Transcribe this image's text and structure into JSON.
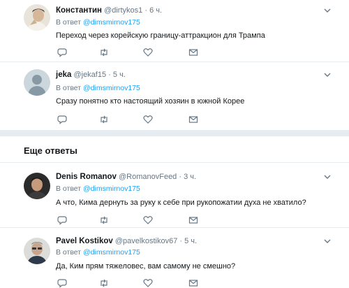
{
  "tweets": [
    {
      "name": "Константин",
      "handle": "@dirtykos1",
      "dot": "·",
      "time": "6 ч.",
      "reply_prefix": "В ответ",
      "reply_mention": "@dimsmirnov175",
      "text": "Переход через корейскую границу-аттракцион для Трампа"
    },
    {
      "name": "jeka",
      "handle": "@jekaf15",
      "dot": "·",
      "time": "5 ч.",
      "reply_prefix": "В ответ",
      "reply_mention": "@dimsmirnov175",
      "text": "Сразу понятно кто настоящий хозяин в южной Корее"
    },
    {
      "name": "Denis Romanov",
      "handle": "@RomanovFeed",
      "dot": "·",
      "time": "3 ч.",
      "reply_prefix": "В ответ",
      "reply_mention": "@dimsmirnov175",
      "text": "А что, Кима дернуть за руку к себе при рукопожатии духа не хватило?"
    },
    {
      "name": "Pavel Kostikov",
      "handle": "@pavelkostikov67",
      "dot": "·",
      "time": "5 ч.",
      "reply_prefix": "В ответ",
      "reply_mention": "@dimsmirnov175",
      "text": "Да,  Ким прям тяжеловес, вам самому не смешно?"
    }
  ],
  "more_replies_label": "Еще ответы",
  "icons": {
    "reply": "reply-icon",
    "retweet": "retweet-icon",
    "like": "heart-icon",
    "dm": "envelope-icon",
    "caret": "chevron-down-icon"
  },
  "colors": {
    "text": "#14171a",
    "muted": "#657786",
    "link": "#1da1f2",
    "divider": "#e6ecf0"
  }
}
